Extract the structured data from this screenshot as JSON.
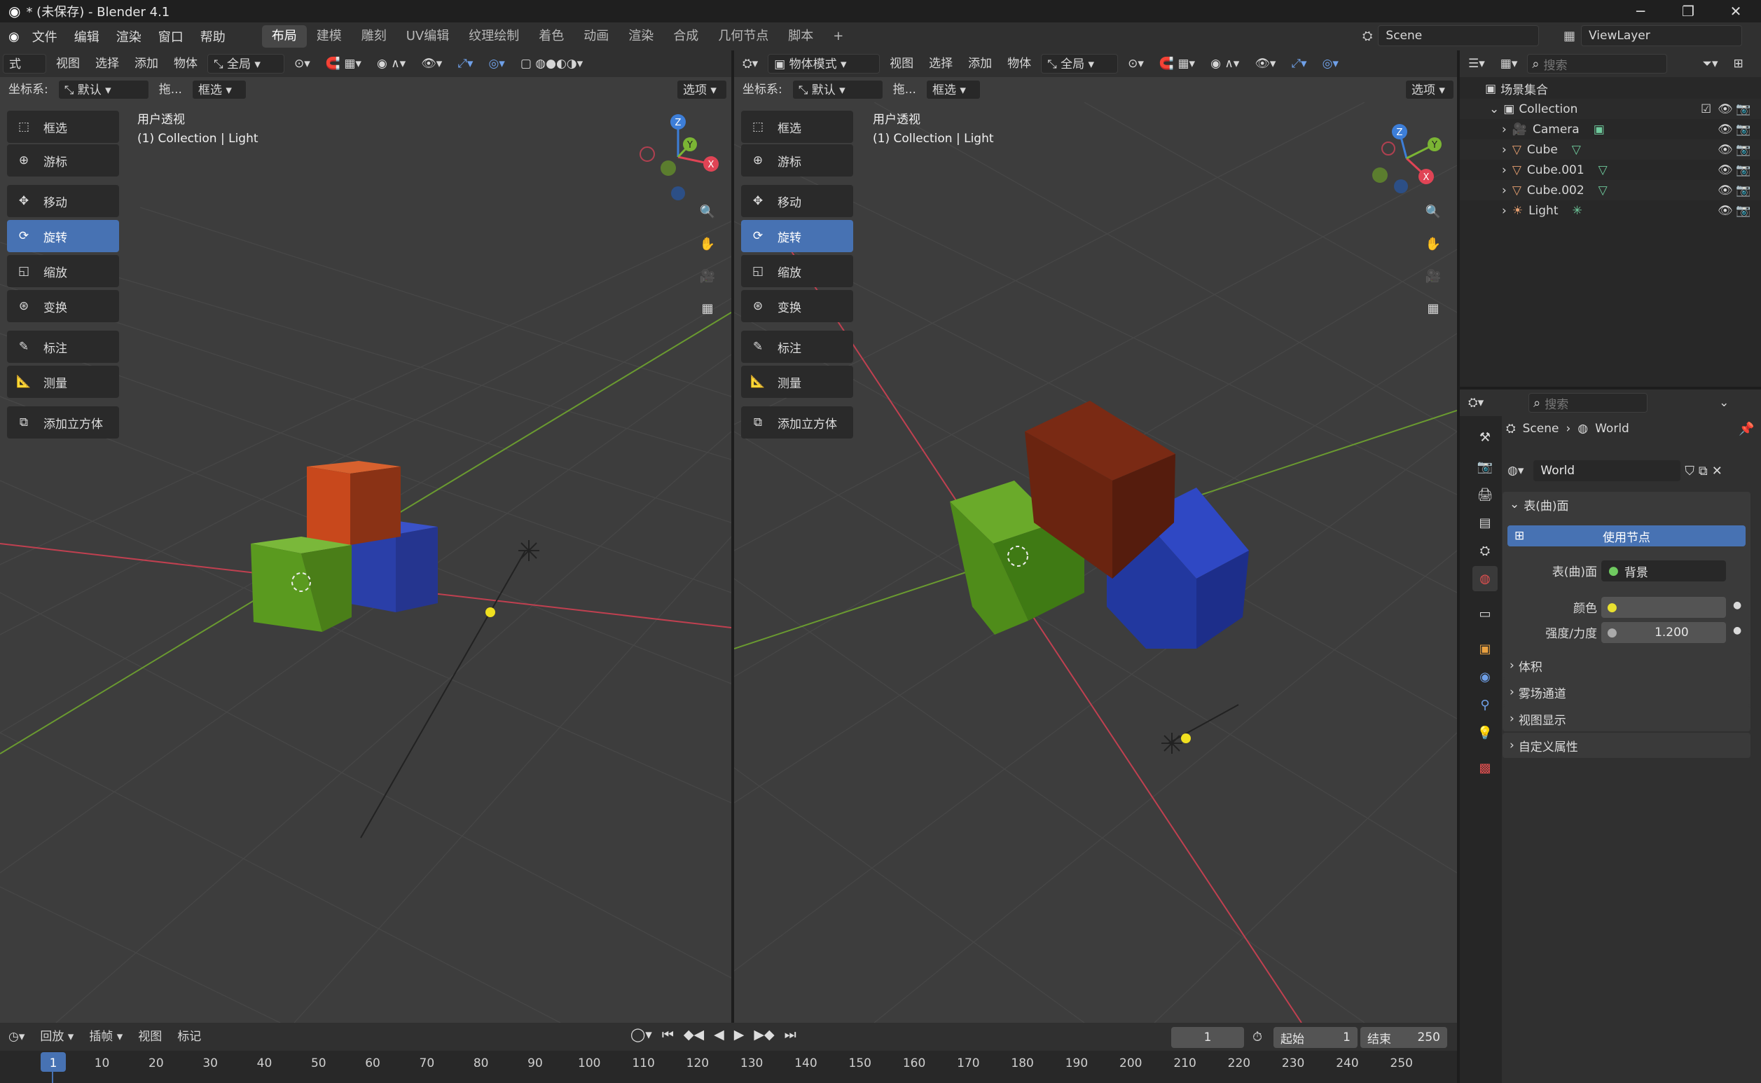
{
  "title": "* (未保存) - Blender 4.1",
  "menu": [
    "文件",
    "编辑",
    "渲染",
    "窗口",
    "帮助"
  ],
  "workspaces": [
    "布局",
    "建模",
    "雕刻",
    "UV编辑",
    "纹理绘制",
    "着色",
    "动画",
    "渲染",
    "合成",
    "几何节点",
    "脚本"
  ],
  "active_workspace": "布局",
  "scene": "Scene",
  "view_layer": "ViewLayer",
  "left_view": {
    "mode_partial": "式",
    "menus": [
      "视图",
      "选择",
      "添加",
      "物体"
    ],
    "orient": "全局",
    "coord_label": "坐标系:",
    "coord_value": "默认",
    "drag": "拖...",
    "select": "框选",
    "options": "选项",
    "title": "用户透视",
    "subtitle": "(1) Collection | Light"
  },
  "right_view": {
    "mode": "物体模式",
    "menus": [
      "视图",
      "选择",
      "添加",
      "物体"
    ],
    "orient": "全局",
    "coord_label": "坐标系:",
    "coord_value": "默认",
    "drag": "拖...",
    "select": "框选",
    "options": "选项",
    "title": "用户透视",
    "subtitle": "(1) Collection | Light"
  },
  "tools": [
    "框选",
    "游标",
    "移动",
    "旋转",
    "缩放",
    "变换",
    "标注",
    "测量",
    "添加立方体"
  ],
  "active_tool": "旋转",
  "gizmo": {
    "x": "X",
    "y": "Y",
    "z": "Z"
  },
  "outliner": {
    "search_placeholder": "搜索",
    "root": "场景集合",
    "collection": "Collection",
    "items": [
      "Camera",
      "Cube",
      "Cube.001",
      "Cube.002",
      "Light"
    ]
  },
  "properties": {
    "search_placeholder": "搜索",
    "breadcrumb_scene": "Scene",
    "breadcrumb_world": "World",
    "world_name": "World",
    "surface_panel": "表(曲)面",
    "use_nodes": "使用节点",
    "surface_label": "表(曲)面",
    "surface_value": "背景",
    "color_label": "颜色",
    "strength_label": "强度/力度",
    "strength_value": "1.200",
    "collapsed_panels": [
      "体积",
      "雾场通道",
      "视图显示",
      "自定义属性"
    ]
  },
  "timeline": {
    "menus": [
      "回放",
      "插帧",
      "视图",
      "标记"
    ],
    "current_frame": "1",
    "start_label": "起始",
    "start_value": "1",
    "end_label": "结束",
    "end_value": "250",
    "ticks": [
      "1",
      "10",
      "20",
      "30",
      "40",
      "50",
      "60",
      "70",
      "80",
      "90",
      "100",
      "110",
      "120",
      "130",
      "140",
      "150",
      "160",
      "170",
      "180",
      "190",
      "200",
      "210",
      "220",
      "230",
      "240",
      "250"
    ]
  },
  "colors": {
    "accent": "#4772b3",
    "cube_green": "#5a9a1f",
    "cube_orange": "#c8481c",
    "cube_blue": "#2a3fa8",
    "axis_red": "#c04050",
    "axis_green": "#6a9a30"
  }
}
